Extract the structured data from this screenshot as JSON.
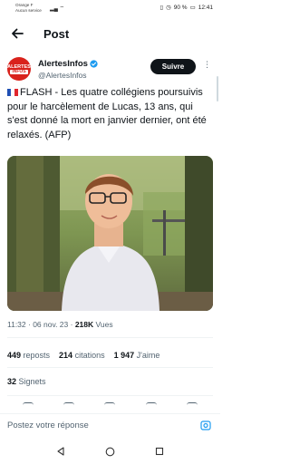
{
  "status_bar": {
    "carrier_line1": "Orange F",
    "carrier_line2": "Aucun service",
    "battery": "90 %",
    "time": "12:41"
  },
  "header": {
    "title": "Post"
  },
  "tweet": {
    "author_name": "AlertesInfos",
    "author_handle": "@AlertesInfos",
    "avatar_text_1": "ALERTES",
    "avatar_text_2": "INFOS",
    "follow_label": "Suivre",
    "more_label": "⋮",
    "text": "FLASH - Les quatre collégiens poursuivis pour le harcèlement de Lucas, 13 ans, qui s'est donné la mort en janvier dernier, ont été relaxés. (AFP)",
    "time": "11:32 · 06 nov. 23 · ",
    "views_count": "218K",
    "views_label": " Vues",
    "reposts_count": "449",
    "reposts_label": " reposts",
    "quotes_count": "214",
    "quotes_label": " citations",
    "likes_count": "1 947",
    "likes_label": " J'aime",
    "bookmarks_count": "32",
    "bookmarks_label": " Signets"
  },
  "reply": {
    "placeholder": "Postez votre réponse"
  },
  "colors": {
    "accent": "#1d9bf0",
    "brand_red": "#d9221c",
    "text": "#0f1419",
    "muted": "#536471"
  }
}
